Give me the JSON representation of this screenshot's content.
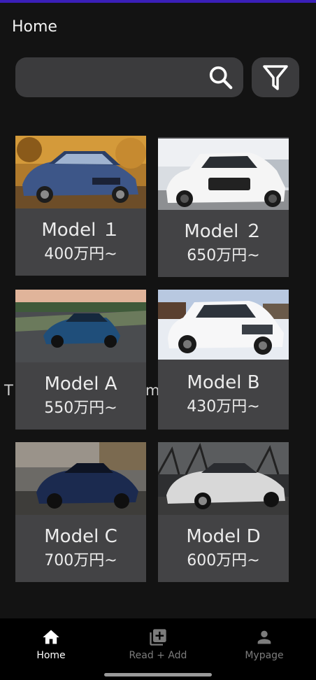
{
  "header": {
    "title": "Home"
  },
  "search": {
    "value": "",
    "icon": "search-icon"
  },
  "filter": {
    "icon": "filter-icon"
  },
  "background_text": {
    "left": "T",
    "right": "m"
  },
  "cars": [
    {
      "name": "Model １",
      "price": "400万円~",
      "image": "blue-sedan"
    },
    {
      "name": "Model ２",
      "price": "650万円~",
      "image": "white-hatchback"
    },
    {
      "name": "Model A",
      "price": "550万円~",
      "image": "blue-sports-car"
    },
    {
      "name": "Model B",
      "price": "430万円~",
      "image": "white-suv"
    },
    {
      "name": "Model C",
      "price": "700万円~",
      "image": "dark-supercar"
    },
    {
      "name": "Model D",
      "price": "600万円~",
      "image": "silver-coupe"
    }
  ],
  "nav": {
    "items": [
      {
        "label": "Home",
        "icon": "home-icon",
        "active": true
      },
      {
        "label": "Read + Add",
        "icon": "library-add-icon",
        "active": false
      },
      {
        "label": "Mypage",
        "icon": "person-icon",
        "active": false
      }
    ]
  },
  "colors": {
    "accent": "#3a1fb8",
    "background": "#131313",
    "card": "#434345",
    "input": "#3b3b3d"
  }
}
